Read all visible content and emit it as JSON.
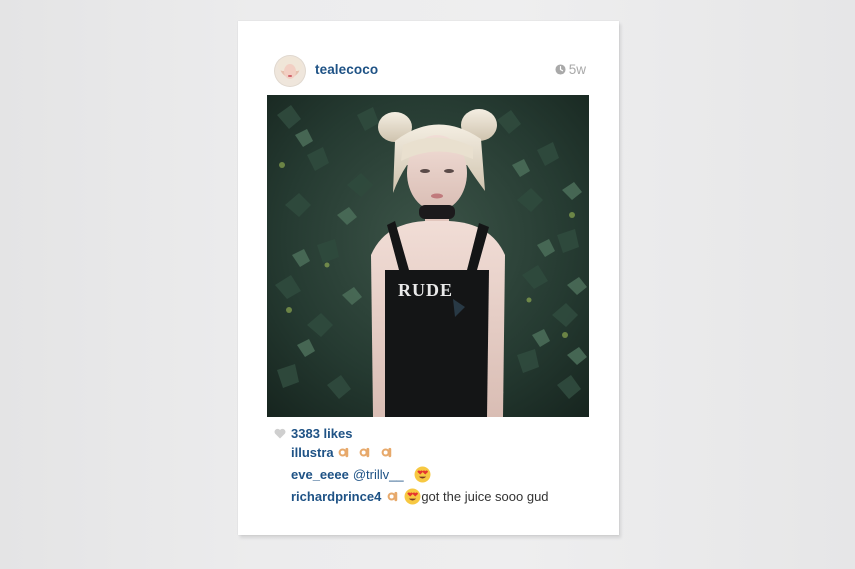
{
  "post": {
    "username": "tealecoco",
    "time": "5w",
    "photo": {
      "shirt_text": "RUDE"
    },
    "likes": "3383 likes",
    "comments": [
      {
        "user": "illustra",
        "mention": "",
        "text": "",
        "emojis": [
          "ok-hand-emoji",
          "ok-hand-emoji",
          "ok-hand-emoji"
        ]
      },
      {
        "user": "eve_eeee",
        "mention": "@trillv__",
        "text": "",
        "emojis": [
          "heart-eyes-emoji"
        ]
      },
      {
        "user": "richardprince4",
        "mention": "",
        "text": "got the juice sooo gud",
        "emojis": [
          "ok-hand-emoji",
          "heart-eyes-emoji"
        ]
      }
    ]
  },
  "icons": {
    "clock": "clock-icon",
    "heart": "heart-icon"
  },
  "colors": {
    "username_blue": "#1e5285",
    "muted_gray": "#a9a9a9",
    "canvas_white": "#ffffff",
    "wall_gray": "#e9e9ea"
  }
}
